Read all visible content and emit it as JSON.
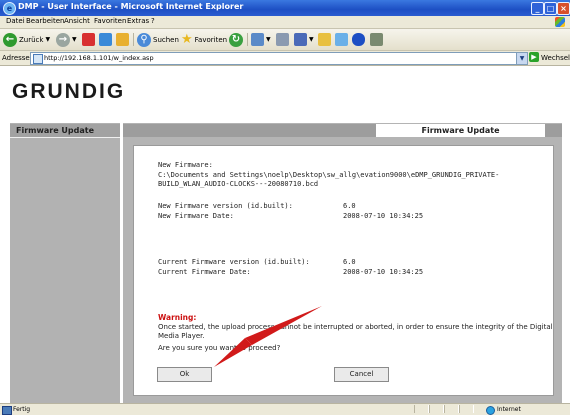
{
  "window": {
    "title": "DMP - User Interface - Microsoft Internet Explorer",
    "controls": {
      "minimize": "_",
      "maximize": "□",
      "close": "×"
    }
  },
  "menu": {
    "items": [
      "Datei",
      "Bearbeiten",
      "Ansicht",
      "Favoriten",
      "Extras",
      "?"
    ]
  },
  "toolbar": {
    "back_label": "Zurück",
    "search_label": "Suchen",
    "favorites_label": "Favoriten",
    "icons": [
      "back-icon",
      "forward-icon",
      "stop-icon",
      "refresh-icon",
      "home-icon",
      "search-icon",
      "favorites-icon",
      "history-icon",
      "mail-icon",
      "print-icon",
      "edit-icon",
      "folder-icon",
      "messenger-icon",
      "bluetooth-icon",
      "tools-icon"
    ]
  },
  "address": {
    "label": "Adresse",
    "url": "http://192.168.1.101/w_index.asp",
    "go_label": "Wechseln zu"
  },
  "page": {
    "logo": "GRUNDIG",
    "sidebar_title": "Firmware Update",
    "tab_title": "Firmware Update",
    "new_firmware": {
      "label": "New Firmware:",
      "path_line1": "C:\\Documents and Settings\\noelp\\Desktop\\sw_allg\\evation9000\\eDMP_GRUNDIG_PRIVATE-",
      "path_line2": "BUILD_WLAN_AUDIO-CLOCKS---20080710.bcd",
      "version_label": "New Firmware version (id.built):",
      "version_value": "6.0",
      "date_label": "New Firmware Date:",
      "date_value": "2008-07-10  10:34:25"
    },
    "current_firmware": {
      "version_label": "Current Firmware version (id.built):",
      "version_value": "6.0",
      "date_label": "Current Firmware Date:",
      "date_value": "2008-07-10  10:34:25"
    },
    "warning": {
      "title": "Warning:",
      "text": "Once started, the upload process cannot be interrupted or aborted, in order to ensure the integrity of the Digital Media Player.",
      "question": "Are you sure you want to proceed?"
    },
    "buttons": {
      "ok": "Ok",
      "cancel": "Cancel"
    }
  },
  "statusbar": {
    "text": "Fertig",
    "zone": "Internet"
  },
  "colors": {
    "titlebar": "#1d4fc4",
    "warning": "#cc1010",
    "annotation_arrow": "#d11a1a",
    "panel_gray": "#b4b4b4"
  }
}
